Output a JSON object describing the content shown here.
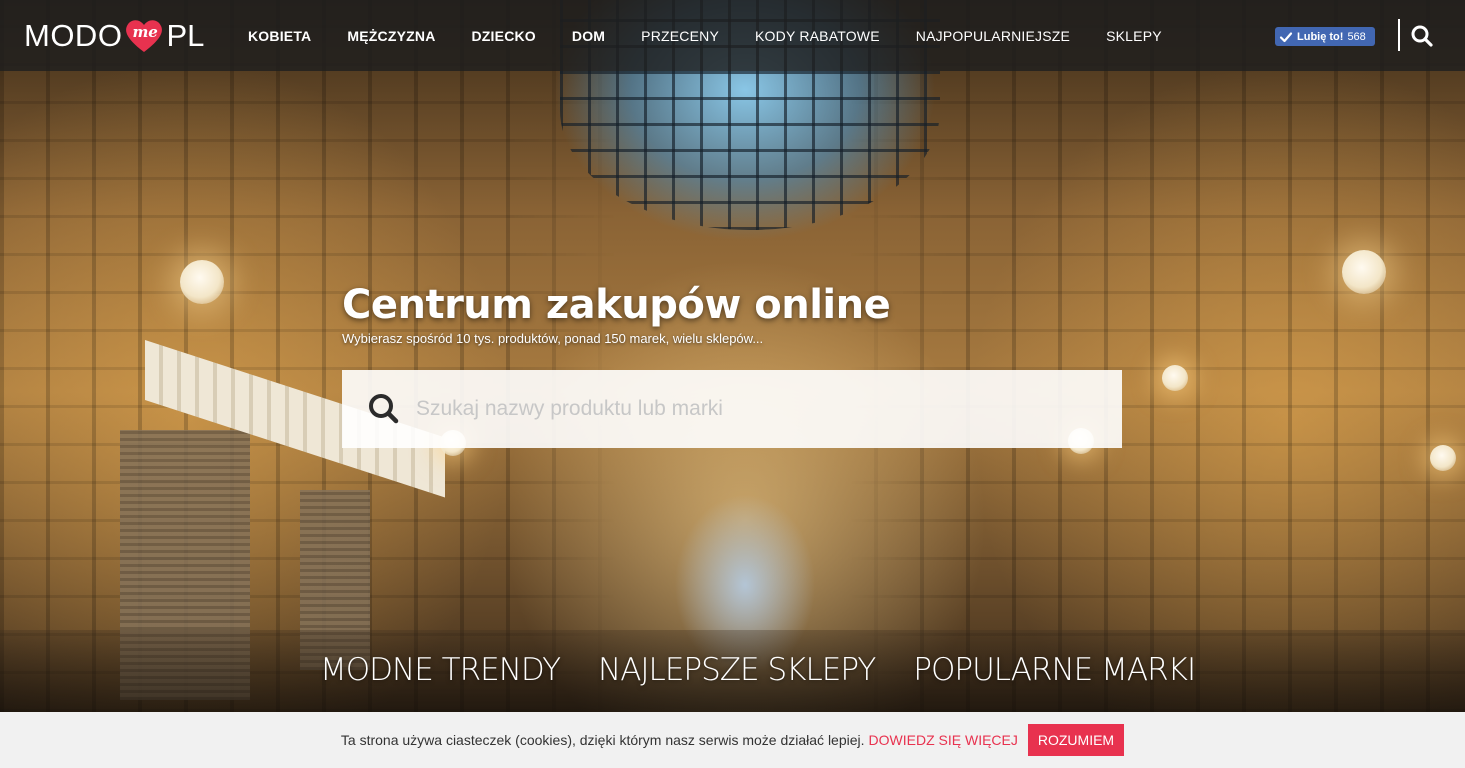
{
  "brand": {
    "logo_left": "MODO",
    "logo_heart": "me",
    "logo_right": "PL",
    "accent_color": "#e8324f"
  },
  "nav": {
    "items": [
      {
        "label": "KOBIETA",
        "bold": true
      },
      {
        "label": "MĘŻCZYZNA",
        "bold": true
      },
      {
        "label": "DZIECKO",
        "bold": true
      },
      {
        "label": "DOM",
        "bold": true
      },
      {
        "label": "PRZECENY",
        "bold": false
      },
      {
        "label": "KODY RABATOWE",
        "bold": false
      },
      {
        "label": "NAJPOPULARNIEJSZE",
        "bold": false
      },
      {
        "label": "SKLEPY",
        "bold": false
      }
    ]
  },
  "facebook": {
    "label": "Lubię to!",
    "count": "568",
    "color": "#4267b2"
  },
  "icons": {
    "header_search": "search-icon",
    "hero_search": "search-icon",
    "fb_check": "check-icon"
  },
  "hero": {
    "title": "Centrum zakupów online",
    "subtitle": "Wybierasz spośród 10 tys. produktów, ponad 150 marek, wielu sklepów...",
    "search_placeholder": "Szukaj nazwy produktu lub marki",
    "search_value": ""
  },
  "tabs": [
    "MODNE TRENDY",
    "NAJLEPSZE SKLEPY",
    "POPULARNE MARKI"
  ],
  "cookie": {
    "text": "Ta strona używa ciasteczek (cookies), dzięki którym nasz serwis może działać lepiej.",
    "more": "DOWIEDZ SIĘ WIĘCEJ",
    "accept": "ROZUMIEM"
  }
}
